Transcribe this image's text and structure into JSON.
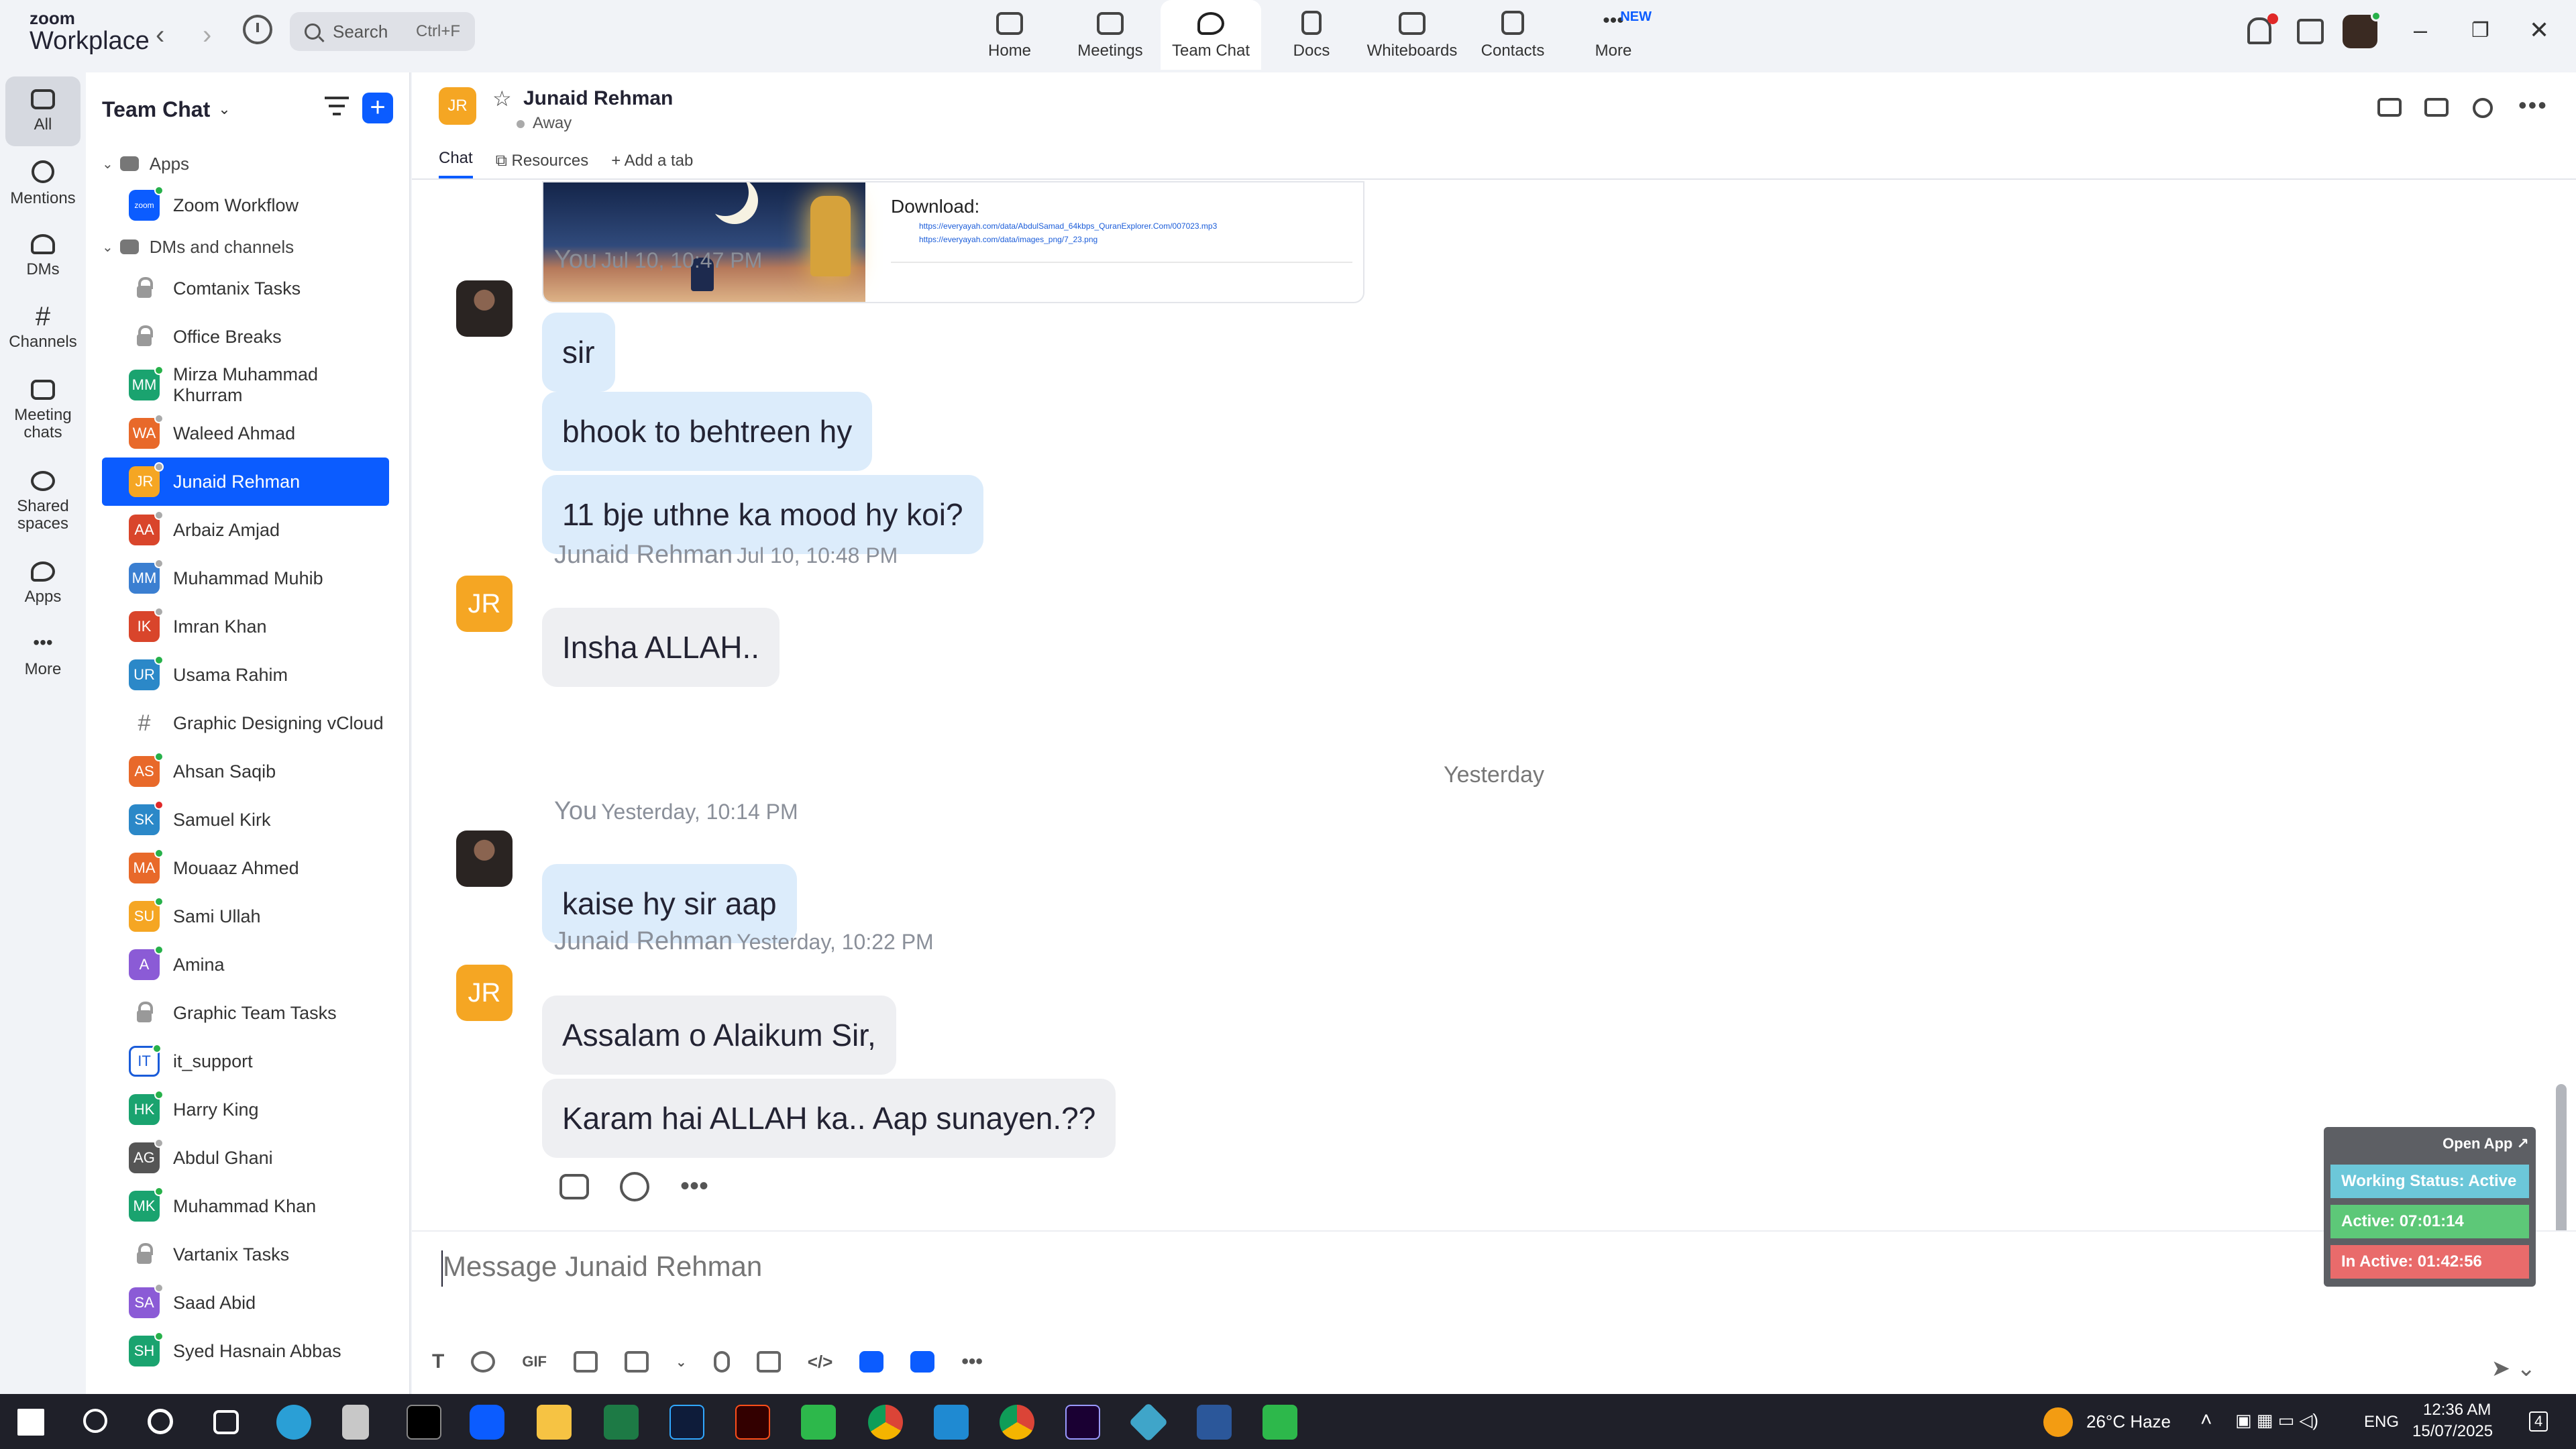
{
  "app": {
    "logo_line1": "zoom",
    "logo_line2": "Workplace"
  },
  "search": {
    "placeholder": "Search",
    "shortcut": "Ctrl+F"
  },
  "main_tabs": [
    {
      "label": "Home",
      "icon": "home-icon"
    },
    {
      "label": "Meetings",
      "icon": "video-camera-icon"
    },
    {
      "label": "Team Chat",
      "icon": "chat-icon",
      "active": true
    },
    {
      "label": "Docs",
      "icon": "doc-icon"
    },
    {
      "label": "Whiteboards",
      "icon": "whiteboard-icon"
    },
    {
      "label": "Contacts",
      "icon": "contacts-icon"
    },
    {
      "label": "More",
      "icon": "more-icon",
      "badge": "NEW"
    }
  ],
  "rail": [
    {
      "label": "All",
      "active": true
    },
    {
      "label": "Mentions"
    },
    {
      "label": "DMs"
    },
    {
      "label": "Channels"
    },
    {
      "label": "Meeting chats"
    },
    {
      "label": "Shared spaces"
    },
    {
      "label": "Apps"
    },
    {
      "label": "More"
    }
  ],
  "sidebar": {
    "title": "Team Chat",
    "apps_section": "Apps",
    "app_item": "Zoom Workflow",
    "dms_section": "DMs and channels",
    "items": [
      {
        "label": "Comtanix Tasks",
        "type": "lock"
      },
      {
        "label": "Office Breaks",
        "type": "lock"
      },
      {
        "label": "Mirza Muhammad Khurram",
        "initials": "MM",
        "color": "#1aa36f",
        "status": "#27b14a"
      },
      {
        "label": "Waleed Ahmad",
        "initials": "WA",
        "color": "#e8692a",
        "status": "#aaaaaa"
      },
      {
        "label": "Junaid Rehman",
        "initials": "JR",
        "color": "#f5a623",
        "status": "#aaaaaa",
        "active": true
      },
      {
        "label": "Arbaiz Amjad",
        "initials": "AA",
        "color": "#d9452b",
        "status": "#aaaaaa"
      },
      {
        "label": "Muhammad Muhib",
        "initials": "MM",
        "color": "#3b7fd1",
        "status": "#aaaaaa"
      },
      {
        "label": "Imran Khan",
        "initials": "IK",
        "color": "#d9452b",
        "status": "#aaaaaa"
      },
      {
        "label": "Usama Rahim",
        "initials": "UR",
        "color": "#2b88c8",
        "status": "#27b14a"
      },
      {
        "label": "Graphic Designing vCloud",
        "type": "hash"
      },
      {
        "label": "Ahsan Saqib",
        "initials": "AS",
        "color": "#e8692a",
        "status": "#27b14a"
      },
      {
        "label": "Samuel Kirk",
        "initials": "SK",
        "color": "#2b88c8",
        "status": "#e02828"
      },
      {
        "label": "Mouaaz Ahmed",
        "initials": "MA",
        "color": "#e8692a",
        "status": "#27b14a"
      },
      {
        "label": "Sami Ullah",
        "initials": "SU",
        "color": "#f5a623",
        "status": "#27b14a"
      },
      {
        "label": "Amina",
        "initials": "A",
        "color": "#8b5bd6",
        "status": "#27b14a"
      },
      {
        "label": "Graphic Team Tasks",
        "type": "lock"
      },
      {
        "label": "it_support",
        "initials": "IT",
        "color": "#ffffff",
        "status": "#27b14a"
      },
      {
        "label": "Harry King",
        "initials": "HK",
        "color": "#1aa36f",
        "status": "#27b14a"
      },
      {
        "label": "Abdul Ghani",
        "initials": "AG",
        "color": "#555555",
        "status": "#aaaaaa"
      },
      {
        "label": "Muhammad Khan",
        "initials": "MK",
        "color": "#1aa36f",
        "status": "#27b14a"
      },
      {
        "label": "Vartanix Tasks",
        "type": "lock"
      },
      {
        "label": "Saad Abid",
        "initials": "SA",
        "color": "#8b5bd6",
        "status": "#aaaaaa"
      },
      {
        "label": "Syed Hasnain Abbas",
        "initials": "SH",
        "color": "#1aa36f",
        "status": "#27b14a"
      }
    ]
  },
  "chat": {
    "contact_initials": "JR",
    "contact_name": "Junaid Rehman",
    "contact_status": "Away",
    "tabs": [
      "Chat",
      "Resources",
      "Add a tab"
    ],
    "attachment": {
      "title": "Download:",
      "links": [
        "https://everyayah.com/data/AbdulSamad_64kbps_QuranExplorer.Com/007023.mp3",
        "https://everyayah.com/data/images_png/7_23.png"
      ]
    },
    "groups": [
      {
        "sender": "You",
        "time": "Jul 10, 10:47 PM",
        "mine": true,
        "messages": [
          "sir",
          "bhook to behtreen hy",
          "11 bje uthne ka mood hy koi?"
        ]
      },
      {
        "sender": "Junaid Rehman",
        "time": "Jul 10, 10:48 PM",
        "mine": false,
        "initials": "JR",
        "messages": [
          "Insha ALLAH.."
        ]
      },
      {
        "sender": "You",
        "time": "Yesterday, 10:14 PM",
        "mine": true,
        "messages": [
          "kaise hy sir aap"
        ]
      },
      {
        "sender": "Junaid Rehman",
        "time": "Yesterday, 10:22 PM",
        "mine": false,
        "initials": "JR",
        "messages": [
          "Assalam o Alaikum Sir,",
          "Karam hai ALLAH ka.. Aap sunayen.??"
        ]
      }
    ],
    "date_separator": "Yesterday",
    "composer_placeholder": "Message Junaid Rehman"
  },
  "widget": {
    "open_app": "Open App ↗",
    "working_status": "Working Status: Active",
    "active": "Active: 07:01:14",
    "inactive": "In Active: 01:42:56",
    "colors": {
      "status": "#6cc7d9",
      "active": "#5dc878",
      "inactive": "#e96b6b"
    }
  },
  "taskbar": {
    "weather": "26°C  Haze",
    "language": "ENG",
    "time": "12:36 AM",
    "date": "15/07/2025",
    "notifications": "4"
  },
  "colors": {
    "accent": "#0b5cff",
    "my_bubble": "#dcecfb",
    "their_bubble": "#eeeff2"
  }
}
